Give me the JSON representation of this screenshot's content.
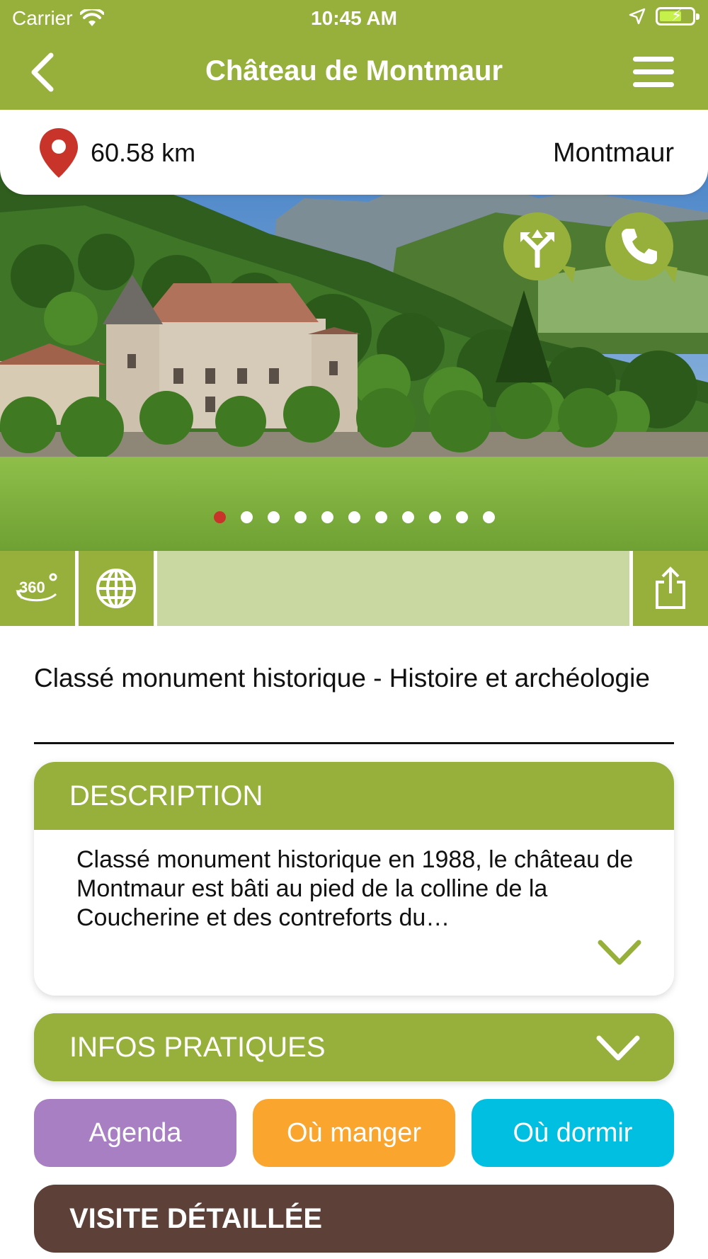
{
  "status_bar": {
    "carrier": "Carrier",
    "time": "10:45 AM"
  },
  "nav": {
    "title": "Château de Montmaur",
    "back_icon": "chevron-left-icon",
    "menu_icon": "hamburger-menu-icon"
  },
  "location": {
    "distance": "60.58 km",
    "town": "Montmaur",
    "pin_color": "#c9342a"
  },
  "hero": {
    "slide_count": 11,
    "active_slide": 1,
    "actions": [
      {
        "name": "directions",
        "icon": "directions-icon"
      },
      {
        "name": "call",
        "icon": "phone-icon"
      }
    ]
  },
  "toolbar": {
    "buttons": [
      {
        "name": "360-view",
        "icon": "360-icon"
      },
      {
        "name": "website",
        "icon": "globe-icon"
      },
      {
        "name": "share",
        "icon": "share-icon"
      }
    ]
  },
  "subtitle": "Classé monument historique - Histoire et archéologie",
  "description": {
    "header": "DESCRIPTION",
    "text": "Classé monument historique en 1988, le château de Montmaur est bâti au pied de la colline de la Coucherine et des contreforts du…"
  },
  "infos_pratiques": {
    "header": "INFOS PRATIQUES"
  },
  "categories": {
    "agenda": "Agenda",
    "manger": "Où manger",
    "dormir": "Où dormir"
  },
  "visite": {
    "label": "VISITE DÉTAILLÉE"
  },
  "colors": {
    "primary_green": "#97b03b",
    "light_green": "#c9d8a0",
    "agenda_purple": "#a97fc4",
    "manger_orange": "#f9a52e",
    "dormir_cyan": "#00bfe0",
    "visite_brown": "#5d4038"
  }
}
